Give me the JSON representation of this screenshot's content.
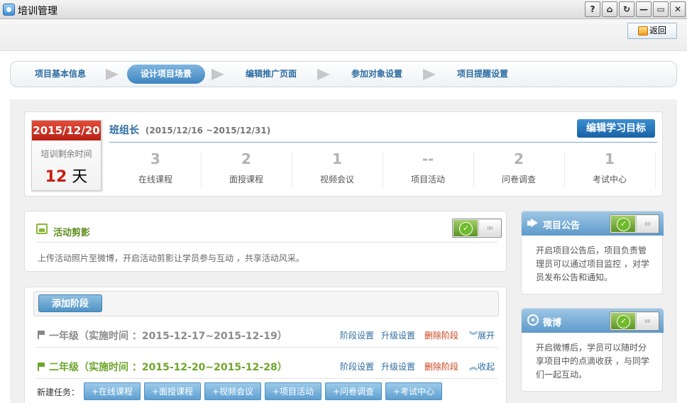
{
  "window": {
    "title": "培训管理",
    "buttons": [
      "?",
      "⌂",
      "↻",
      "—",
      "▭",
      "✕"
    ]
  },
  "header": {
    "back_label": "返回"
  },
  "wizard": {
    "steps": [
      {
        "label": "项目基本信息"
      },
      {
        "label": "设计项目场景",
        "active": true
      },
      {
        "label": "编辑推广页面"
      },
      {
        "label": "参加对象设置"
      },
      {
        "label": "项目提醒设置"
      }
    ]
  },
  "summary": {
    "date": "2015/12/20",
    "remaining_label": "培训剩余时间",
    "remaining_value": "12",
    "remaining_unit": "天",
    "role": "班组长",
    "role_range": "(2015/12/16 ~2015/12/31)",
    "goal_button": "编辑学习目标",
    "stats": [
      {
        "value": "3",
        "label": "在线课程"
      },
      {
        "value": "2",
        "label": "面授课程"
      },
      {
        "value": "1",
        "label": "视频会议"
      },
      {
        "value": "--",
        "label": "项目活动"
      },
      {
        "value": "2",
        "label": "问卷调查"
      },
      {
        "value": "1",
        "label": "考试中心"
      }
    ]
  },
  "activity": {
    "title": "活动剪影",
    "desc": "上传活动照片至微博，开启活动剪影让学员参与互动 ，共享活动风采。"
  },
  "stages": {
    "add_button": "添加阶段",
    "items": [
      {
        "title": "一年级（实施时间 ：2015-12-17~2015-12-19）",
        "settings": "阶段设置",
        "upgrade": "升级设置",
        "delete": "删除阶段",
        "toggle": "展开"
      },
      {
        "title": "二年级（实施时间 ：2015-12-20~2015-12-28）",
        "settings": "阶段设置",
        "upgrade": "升级设置",
        "delete": "删除阶段",
        "toggle": "收起"
      }
    ],
    "new_task_label": "新建任务：",
    "task_buttons": [
      "+在线课程",
      "+面授课程",
      "+视频会议",
      "+项目活动",
      "+问卷调查",
      "+考试中心"
    ]
  },
  "announcement": {
    "title": "项目公告",
    "desc": "开启项目公告后，项目负责管理员可以通过项目监控 ，对学员发布公告和通知。"
  },
  "weibo": {
    "title": "微博",
    "desc": "开启微博后，学员可以随时分享项目中的点滴收获 ，与同学们一起互动。"
  }
}
